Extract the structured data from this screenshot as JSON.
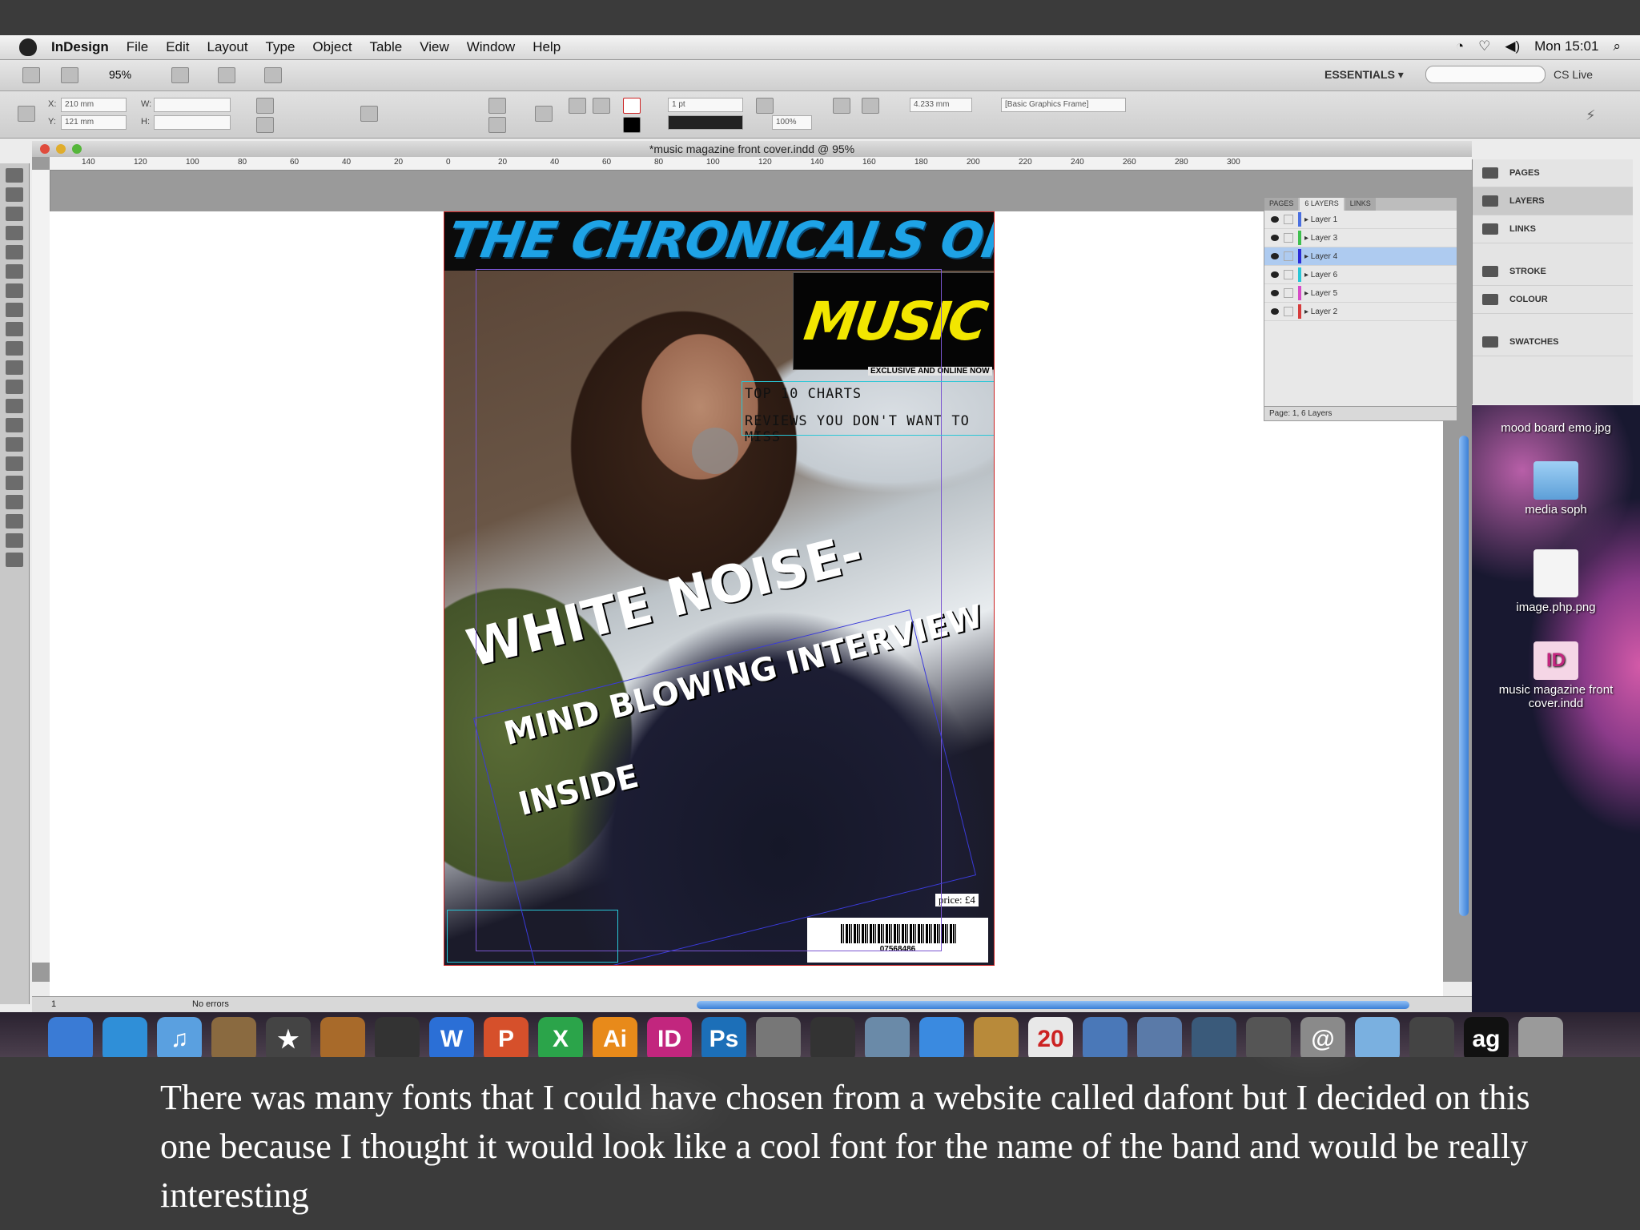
{
  "menubar": {
    "app": "InDesign",
    "items": [
      "File",
      "Edit",
      "Layout",
      "Type",
      "Object",
      "Table",
      "View",
      "Window",
      "Help"
    ],
    "clock": "Mon 15:01"
  },
  "control": {
    "zoom": "95%",
    "workspace": "ESSENTIALS ▾",
    "cs_live": "CS Live",
    "x": "210 mm",
    "y": "121 mm",
    "stroke_weight": "1 pt",
    "scale": "100%",
    "ref_value": "4.233 mm",
    "object_style": "[Basic Graphics Frame]"
  },
  "document": {
    "title": "*music magazine front cover.indd @ 95%",
    "status": "No errors",
    "page_num": "1",
    "ruler_ticks": [
      "140",
      "120",
      "100",
      "80",
      "60",
      "40",
      "20",
      "0",
      "20",
      "40",
      "60",
      "80",
      "100",
      "120",
      "140",
      "160",
      "180",
      "200",
      "220",
      "240",
      "260",
      "280",
      "300"
    ]
  },
  "cover": {
    "masthead": "THE CHRONICALS OF",
    "music": "MUSIC",
    "tagline": "EXCLUSIVE AND ONLINE NOW",
    "line1": "TOP 10 CHARTS",
    "line2": "REVIEWS YOU DON'T WANT TO MISS",
    "headline1": "WHITE NOISE-",
    "headline2": "MIND BLOWING INTERVIEW",
    "headline3": "INSIDE",
    "price": "price: £4",
    "barcode_number": "07568486"
  },
  "layers_panel": {
    "tabs": [
      "PAGES",
      "6 LAYERS",
      "LINKS"
    ],
    "layers": [
      {
        "name": "Layer 1",
        "color": "#4a6fe0",
        "selected": false
      },
      {
        "name": "Layer 3",
        "color": "#3fbf4f",
        "selected": false
      },
      {
        "name": "Layer 4",
        "color": "#2b2bd8",
        "selected": true
      },
      {
        "name": "Layer 6",
        "color": "#29c6d6",
        "selected": false
      },
      {
        "name": "Layer 5",
        "color": "#d64bc7",
        "selected": false
      },
      {
        "name": "Layer 2",
        "color": "#d63b3b",
        "selected": false
      }
    ],
    "footer": "Page: 1, 6 Layers"
  },
  "dock_panel": {
    "items": [
      "PAGES",
      "LAYERS",
      "LINKS",
      "STROKE",
      "COLOUR",
      "SWATCHES"
    ]
  },
  "desktop": {
    "file1": "mood board emo.jpg",
    "file2": "media soph",
    "file3": "image.php.png",
    "file4": "music magazine front cover.indd"
  },
  "dock_icons": [
    {
      "name": "finder-icon",
      "label": "",
      "color": "#3a7bd5"
    },
    {
      "name": "safari-icon",
      "label": "",
      "color": "#2f8fd8"
    },
    {
      "name": "itunes-icon",
      "label": "♫",
      "color": "#5aa0e0"
    },
    {
      "name": "iphoto-icon",
      "label": "",
      "color": "#8a6a40"
    },
    {
      "name": "imovie-icon",
      "label": "★",
      "color": "#444"
    },
    {
      "name": "garageband-icon",
      "label": "",
      "color": "#a86a2a"
    },
    {
      "name": "clapper-icon",
      "label": "",
      "color": "#333"
    },
    {
      "name": "word-icon",
      "label": "W",
      "color": "#2b6fd6"
    },
    {
      "name": "powerpoint-icon",
      "label": "P",
      "color": "#d6502b"
    },
    {
      "name": "excel-icon",
      "label": "X",
      "color": "#2ba44a"
    },
    {
      "name": "illustrator-icon",
      "label": "Ai",
      "color": "#e88a1a"
    },
    {
      "name": "indesign-icon",
      "label": "ID",
      "color": "#c2267e"
    },
    {
      "name": "photoshop-icon",
      "label": "Ps",
      "color": "#1c6fb8"
    },
    {
      "name": "preferences-icon",
      "label": "",
      "color": "#777"
    },
    {
      "name": "dashboard-icon",
      "label": "",
      "color": "#333"
    },
    {
      "name": "mail-icon",
      "label": "",
      "color": "#6a8aa8"
    },
    {
      "name": "ichat-icon",
      "label": "",
      "color": "#3a8ae0"
    },
    {
      "name": "addressbook-icon",
      "label": "",
      "color": "#b88a3a"
    },
    {
      "name": "ical-icon",
      "label": "20",
      "color": "#e8e8e8"
    },
    {
      "name": "preview-icon",
      "label": "",
      "color": "#4a78b8"
    },
    {
      "name": "spaces-icon",
      "label": "",
      "color": "#5a7aa8"
    },
    {
      "name": "timemachine-icon",
      "label": "",
      "color": "#3a5a7a"
    },
    {
      "name": "photo-stack-icon",
      "label": "",
      "color": "#555"
    },
    {
      "name": "mail-stack-icon",
      "label": "@",
      "color": "#8a8a8a"
    },
    {
      "name": "folder-icon",
      "label": "",
      "color": "#7ab0e0"
    },
    {
      "name": "documents-icon",
      "label": "",
      "color": "#444"
    },
    {
      "name": "ag-icon",
      "label": "ag",
      "color": "#111"
    },
    {
      "name": "trash-icon",
      "label": "",
      "color": "#9a9a9a"
    }
  ],
  "caption": "There was many fonts that I could have chosen from a website called dafont but I decided on this one because I thought it would look like a  cool font for the name of  the band and would be really interesting",
  "colors": {
    "masthead": "#1ea3e6",
    "music": "#f2e600",
    "selection": "#3b7fd6"
  }
}
